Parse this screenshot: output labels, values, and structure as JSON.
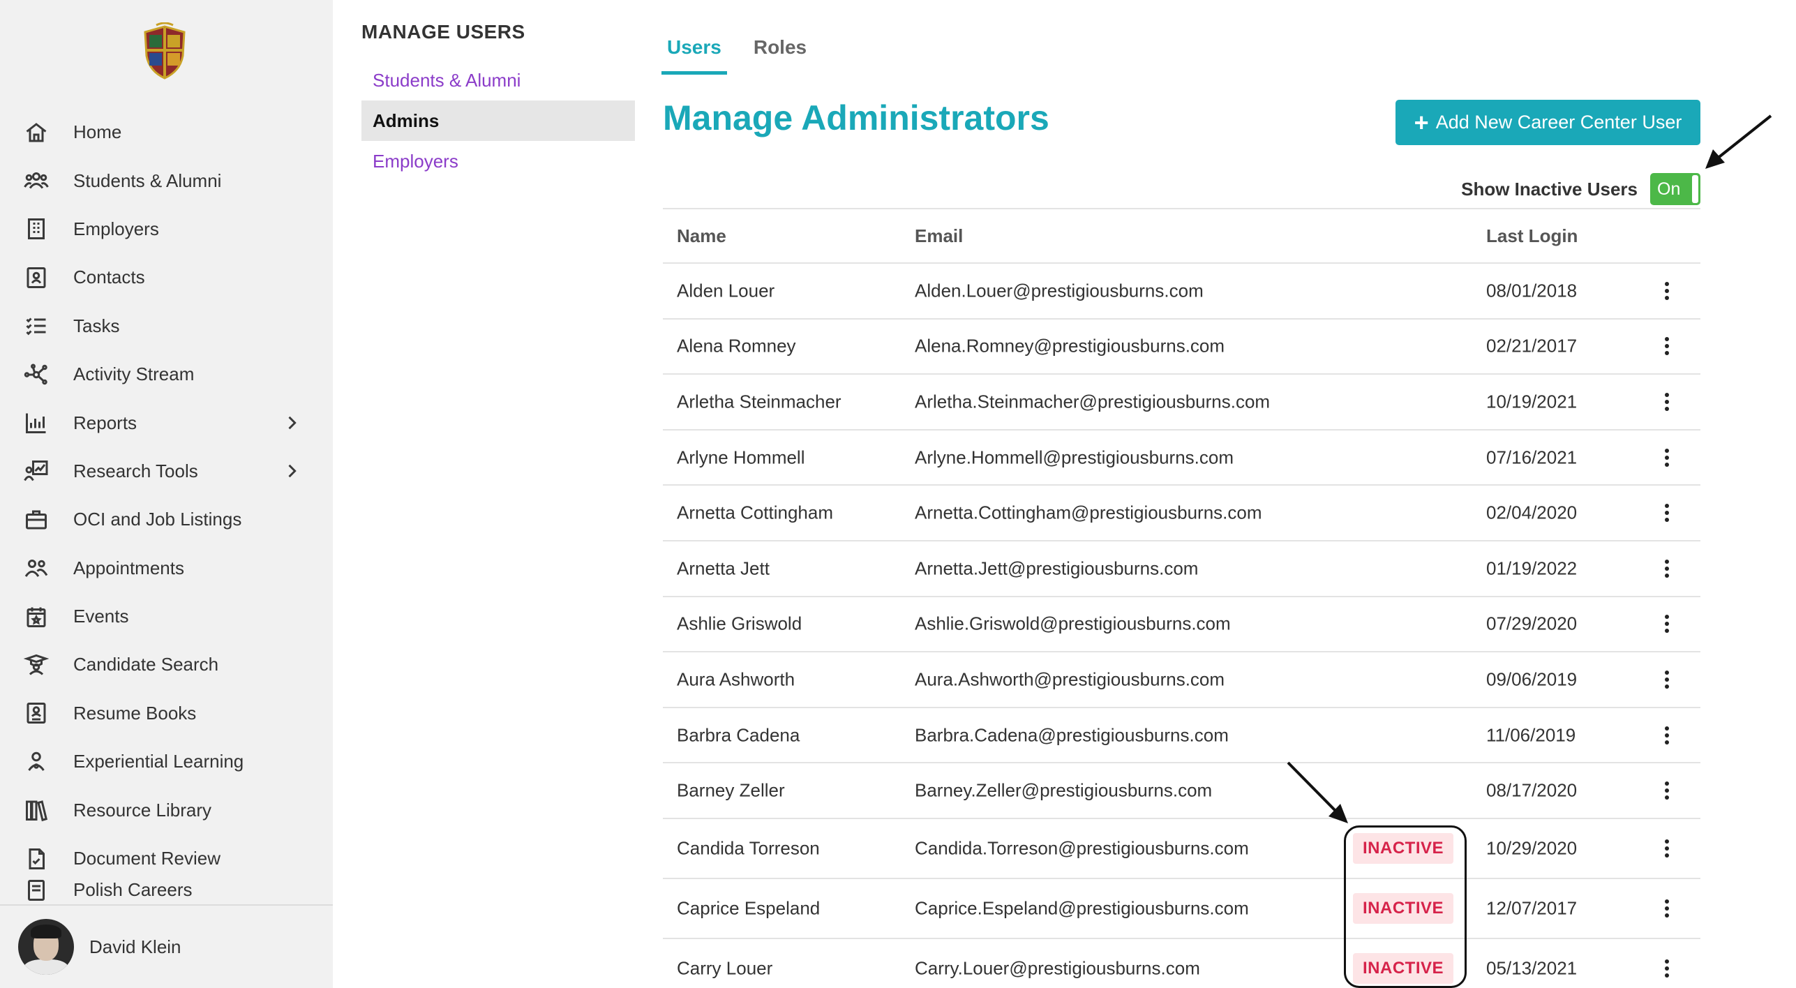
{
  "sidebar": {
    "items": [
      {
        "label": "Home",
        "icon": "home-icon"
      },
      {
        "label": "Students & Alumni",
        "icon": "people-group-icon"
      },
      {
        "label": "Employers",
        "icon": "building-icon"
      },
      {
        "label": "Contacts",
        "icon": "contact-card-icon"
      },
      {
        "label": "Tasks",
        "icon": "checklist-icon"
      },
      {
        "label": "Activity Stream",
        "icon": "network-icon"
      },
      {
        "label": "Reports",
        "icon": "bar-chart-icon",
        "chevron": true
      },
      {
        "label": "Research Tools",
        "icon": "chart-person-icon",
        "chevron": true
      },
      {
        "label": "OCI and Job Listings",
        "icon": "briefcase-icon"
      },
      {
        "label": "Appointments",
        "icon": "people-icon"
      },
      {
        "label": "Events",
        "icon": "calendar-star-icon"
      },
      {
        "label": "Candidate Search",
        "icon": "graduate-icon"
      },
      {
        "label": "Resume Books",
        "icon": "resume-book-icon"
      },
      {
        "label": "Experiential Learning",
        "icon": "person-badge-icon"
      },
      {
        "label": "Resource Library",
        "icon": "library-icon"
      },
      {
        "label": "Document Review",
        "icon": "document-check-icon"
      }
    ],
    "clipped_item": {
      "label": "Polish Careers",
      "icon": "document-icon"
    },
    "user": {
      "name": "David Klein"
    }
  },
  "subnav": {
    "title": "MANAGE USERS",
    "items": [
      {
        "label": "Students & Alumni",
        "active": false
      },
      {
        "label": "Admins",
        "active": true
      },
      {
        "label": "Employers",
        "active": false
      }
    ]
  },
  "tabs": [
    {
      "label": "Users",
      "active": true
    },
    {
      "label": "Roles",
      "active": false
    }
  ],
  "page": {
    "title": "Manage Administrators",
    "add_button": "Add New Career Center User",
    "toggle_label": "Show Inactive Users",
    "toggle_value": "On"
  },
  "table": {
    "headers": {
      "name": "Name",
      "email": "Email",
      "last_login": "Last Login"
    },
    "rows": [
      {
        "name": "Alden Louer",
        "email": "Alden.Louer@prestigiousburns.com",
        "status": "",
        "last_login": "08/01/2018"
      },
      {
        "name": "Alena Romney",
        "email": "Alena.Romney@prestigiousburns.com",
        "status": "",
        "last_login": "02/21/2017"
      },
      {
        "name": "Arletha Steinmacher",
        "email": "Arletha.Steinmacher@prestigiousburns.com",
        "status": "",
        "last_login": "10/19/2021"
      },
      {
        "name": "Arlyne Hommell",
        "email": "Arlyne.Hommell@prestigiousburns.com",
        "status": "",
        "last_login": "07/16/2021"
      },
      {
        "name": "Arnetta Cottingham",
        "email": "Arnetta.Cottingham@prestigiousburns.com",
        "status": "",
        "last_login": "02/04/2020"
      },
      {
        "name": "Arnetta Jett",
        "email": "Arnetta.Jett@prestigiousburns.com",
        "status": "",
        "last_login": "01/19/2022"
      },
      {
        "name": "Ashlie Griswold",
        "email": "Ashlie.Griswold@prestigiousburns.com",
        "status": "",
        "last_login": "07/29/2020"
      },
      {
        "name": "Aura Ashworth",
        "email": "Aura.Ashworth@prestigiousburns.com",
        "status": "",
        "last_login": "09/06/2019"
      },
      {
        "name": "Barbra Cadena",
        "email": "Barbra.Cadena@prestigiousburns.com",
        "status": "",
        "last_login": "11/06/2019"
      },
      {
        "name": "Barney Zeller",
        "email": "Barney.Zeller@prestigiousburns.com",
        "status": "",
        "last_login": "08/17/2020"
      },
      {
        "name": "Candida Torreson",
        "email": "Candida.Torreson@prestigiousburns.com",
        "status": "INACTIVE",
        "last_login": "10/29/2020"
      },
      {
        "name": "Caprice Espeland",
        "email": "Caprice.Espeland@prestigiousburns.com",
        "status": "INACTIVE",
        "last_login": "12/07/2017"
      },
      {
        "name": "Carry Louer",
        "email": "Carry.Louer@prestigiousburns.com",
        "status": "INACTIVE",
        "last_login": "05/13/2021"
      }
    ]
  },
  "colors": {
    "accent": "#1aa8b8",
    "link_purple": "#8b3cc9",
    "toggle_green": "#4cb848",
    "inactive_text": "#d6234a",
    "inactive_bg": "#fde4e6",
    "sidebar_bg": "#f1f1f1"
  }
}
